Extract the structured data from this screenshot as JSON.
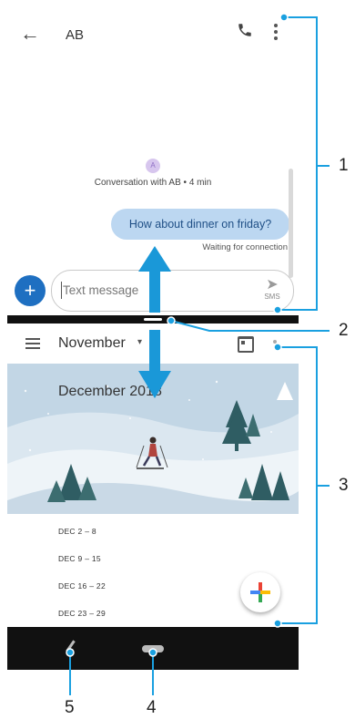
{
  "messaging": {
    "contact_name": "AB",
    "conversation_info": "Conversation with AB • 4 min",
    "avatar_letter": "A",
    "message_text": "How about dinner on friday?",
    "message_status": "Waiting for connection",
    "input_placeholder": "Text message",
    "send_label": "SMS"
  },
  "calendar": {
    "month_label": "November",
    "hero_title": "December 2018",
    "weeks": [
      "DEC 2 – 8",
      "DEC 9 – 15",
      "DEC 16 – 22",
      "DEC 23 – 29"
    ]
  },
  "callouts": {
    "one": "1",
    "two": "2",
    "three": "3",
    "four": "4",
    "five": "5"
  },
  "colors": {
    "accent": "#1aa0e0",
    "bubble": "#bcd7f1",
    "plus_button": "#1e6fc1"
  }
}
